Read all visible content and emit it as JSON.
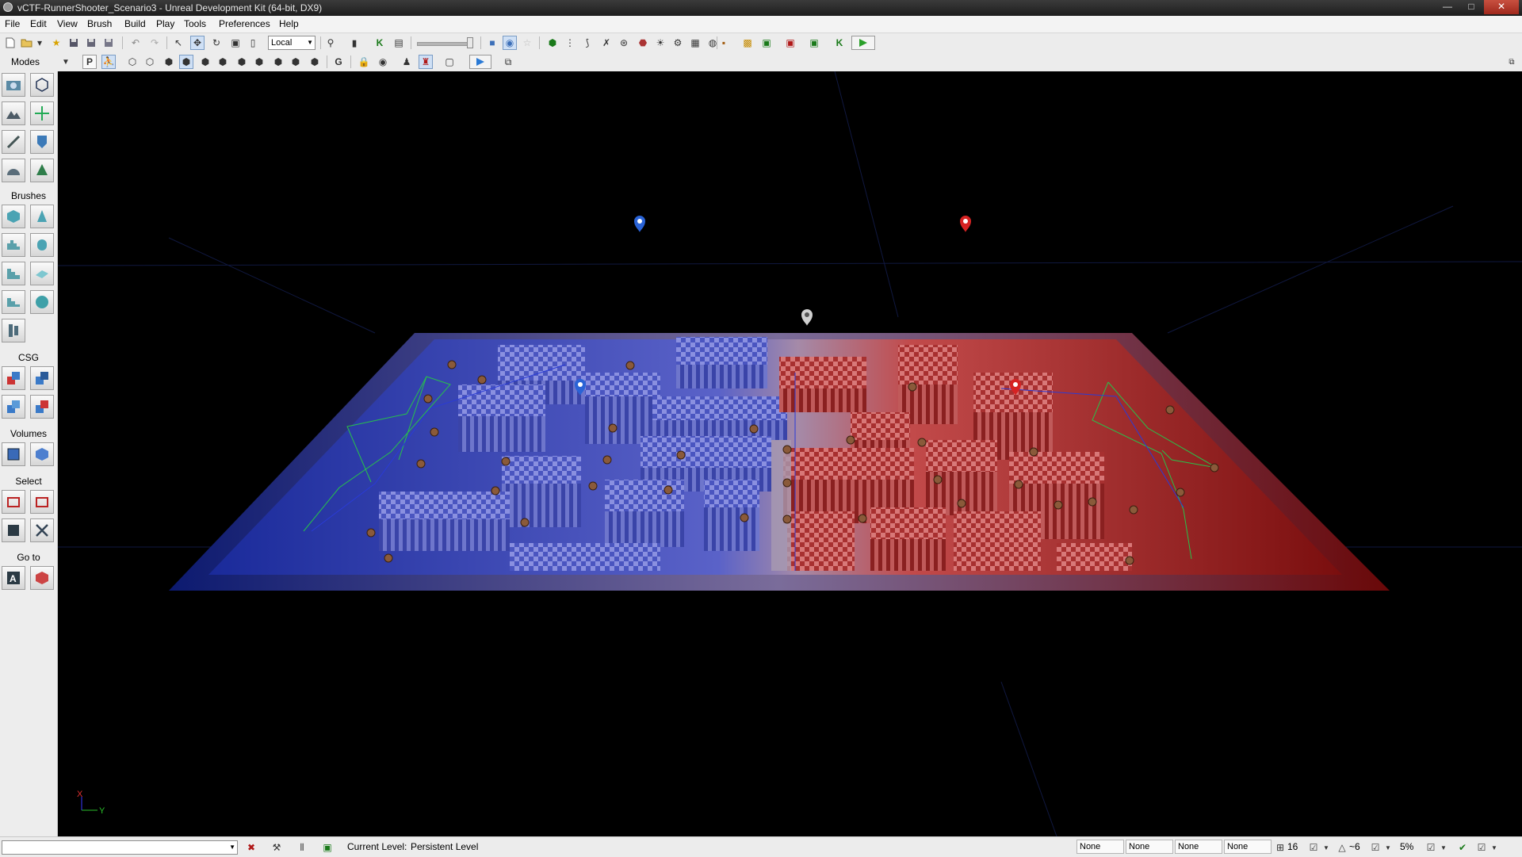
{
  "window": {
    "title": "vCTF-RunnerShooter_Scenario3 - Unreal Development Kit (64-bit, DX9)",
    "controls": {
      "minimize": "—",
      "maximize": "□",
      "close": "✕"
    }
  },
  "menu": [
    "File",
    "Edit",
    "View",
    "Brush",
    "Build",
    "Play",
    "Tools",
    "Preferences",
    "Help"
  ],
  "toolbar1": {
    "coordinate_system": "Local",
    "left_icons": [
      "new-icon",
      "open-icon",
      "recent-dropdown-icon",
      "favorites-icon",
      "save-icon",
      "save-as-icon",
      "save-all-icon",
      "undo-icon",
      "redo-icon",
      "select-icon",
      "translate-icon",
      "rotate-icon",
      "scale-icon",
      "scale-nonuniform-icon"
    ],
    "mid_icons": [
      "find-actor-icon",
      "kismet-bar-icon",
      "kismet-icon",
      "matinee-icon"
    ],
    "right_icons": [
      "realtime-icon",
      "lighting-icon",
      "star-icon",
      "build-geometry-icon",
      "build-light-icon",
      "build-paths-icon",
      "build-covers-icon",
      "build-all-icon",
      "build-content-icon",
      "lighting-quality-icon",
      "play-quality-icon",
      "map-check-icon",
      "content-browser-icon",
      "package-icon",
      "cascade-icon",
      "kismet-open-icon",
      "console-icon",
      "play-in-editor-icon",
      "play-on-pc-icon"
    ]
  },
  "toolbar2": {
    "icons": [
      "perspective-icon",
      "game-view-icon",
      "wireframe-brush-icon",
      "wireframe-icon",
      "unlit-icon",
      "lit-icon",
      "detail-lighting-icon",
      "lighting-only-icon",
      "light-complexity-icon",
      "texture-density-icon",
      "shader-complexity-icon",
      "lightmap-density-icon",
      "collision-icon",
      "lock-icon",
      "camera-view-icon",
      "player-start-icon",
      "actor-visibility-icon",
      "bounding-box-icon",
      "realtime-preview-icon",
      "viewport-window-icon"
    ],
    "labels": {
      "perspective": "P",
      "grid": "G"
    }
  },
  "sidebar": {
    "sections": [
      {
        "title": "Modes",
        "icons": [
          "camera-mode-icon",
          "geometry-mode-icon",
          "terrain-mode-icon",
          "texture-align-icon",
          "mesh-paint-icon",
          "landscape-icon",
          "static-mesh-icon",
          "foliage-icon"
        ]
      },
      {
        "title": "Brushes",
        "icons": [
          "cube-brush-icon",
          "cone-brush-icon",
          "curved-stair-icon",
          "cylinder-brush-icon",
          "linear-stair-icon",
          "sheet-brush-icon",
          "spiral-stair-icon",
          "sphere-brush-icon",
          "volumetric-brush-icon"
        ]
      },
      {
        "title": "CSG",
        "icons": [
          "csg-add-icon",
          "csg-subtract-icon",
          "csg-intersect-icon",
          "csg-deintersect-icon"
        ]
      },
      {
        "title": "Volumes",
        "icons": [
          "add-volume-icon",
          "volume-options-icon"
        ]
      },
      {
        "title": "Select",
        "icons": [
          "show-selected-icon",
          "hide-selected-icon",
          "select-invert-icon",
          "show-all-icon"
        ]
      },
      {
        "title": "Go to",
        "icons": [
          "goto-actor-icon",
          "goto-builder-brush-icon"
        ]
      }
    ]
  },
  "viewport": {
    "axis": {
      "x": "X",
      "y": "Y"
    },
    "markers": [
      {
        "name": "blue-flag-base-icon",
        "color": "#2a63d6"
      },
      {
        "name": "red-flag-base-icon",
        "color": "#d62323"
      },
      {
        "name": "neutral-spawn-icon",
        "color": "#cfcfcf"
      },
      {
        "name": "blue-spawn-icon",
        "color": "#2a63d6"
      },
      {
        "name": "red-spawn-icon",
        "color": "#d62323"
      }
    ]
  },
  "statusbar": {
    "current_level_label": "Current Level:",
    "current_level_value": "Persistent Level",
    "fields": [
      "None",
      "None",
      "None",
      "None"
    ],
    "grid_size": "16",
    "rotation_snap": "~6",
    "scale_snap": "5%"
  }
}
